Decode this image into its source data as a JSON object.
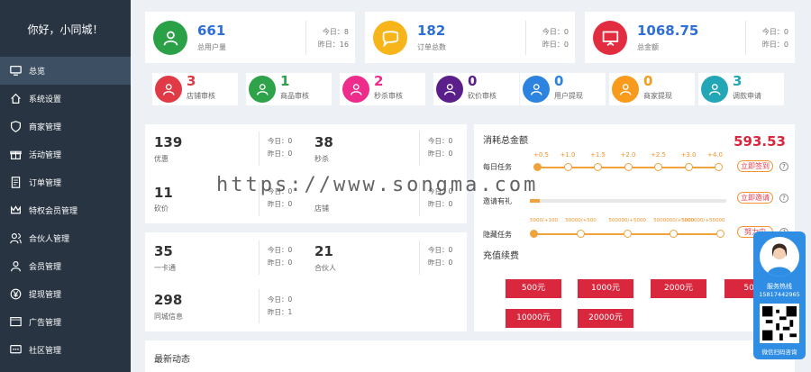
{
  "sidebar": {
    "greeting": "你好，小同城！",
    "items": [
      {
        "label": "总览",
        "icon": "monitor-icon"
      },
      {
        "label": "系统设置",
        "icon": "home-icon"
      },
      {
        "label": "商家管理",
        "icon": "shield-icon"
      },
      {
        "label": "活动管理",
        "icon": "gift-icon"
      },
      {
        "label": "订单管理",
        "icon": "document-icon"
      },
      {
        "label": "特权会员管理",
        "icon": "crown-icon"
      },
      {
        "label": "合伙人管理",
        "icon": "users-icon"
      },
      {
        "label": "会员管理",
        "icon": "user-group-icon"
      },
      {
        "label": "提现管理",
        "icon": "yen-icon"
      },
      {
        "label": "广告管理",
        "icon": "ad-icon"
      },
      {
        "label": "社区管理",
        "icon": "chat-icon"
      }
    ]
  },
  "stats": [
    {
      "value": "661",
      "label": "总用户量",
      "today_label": "今日：8",
      "yesterday_label": "昨日：16",
      "color": "#2aa146",
      "icon": "user-icon"
    },
    {
      "value": "182",
      "label": "订单总数",
      "today_label": "今日：0",
      "yesterday_label": "昨日：0",
      "color": "#f7b51a",
      "icon": "chat-bubble-icon"
    },
    {
      "value": "1068.75",
      "label": "总金额",
      "today_label": "今日：0",
      "yesterday_label": "昨日：0",
      "color": "#e12d3f",
      "icon": "presentation-icon"
    }
  ],
  "reviews": [
    {
      "value": "3",
      "label": "店铺审核",
      "color": "#e03a47"
    },
    {
      "value": "1",
      "label": "商品审核",
      "color": "#2ea349"
    },
    {
      "value": "2",
      "label": "秒杀审核",
      "color": "#ee2c8b"
    },
    {
      "value": "0",
      "label": "砍价审核",
      "color": "#5a1f8a"
    },
    {
      "value": "0",
      "label": "用户提现",
      "color": "#2d84e0"
    },
    {
      "value": "0",
      "label": "商家提现",
      "color": "#f89a1c"
    },
    {
      "value": "3",
      "label": "调款申请",
      "color": "#23a6b5"
    }
  ],
  "counts": {
    "block1": [
      {
        "value": "139",
        "label": "优惠",
        "today_label": "今日：0",
        "yesterday_label": "昨日：0"
      },
      {
        "value": "38",
        "label": "秒杀",
        "today_label": "今日：0",
        "yesterday_label": "昨日：0"
      },
      {
        "value": "11",
        "label": "砍价",
        "today_label": "今日：0",
        "yesterday_label": "昨日：0"
      },
      {
        "value": "",
        "label": "店铺",
        "today_label": "今日：0",
        "yesterday_label": "昨日：0"
      }
    ],
    "block2": [
      {
        "value": "35",
        "label": "一卡通",
        "today_label": "今日：0",
        "yesterday_label": "昨日：0"
      },
      {
        "value": "21",
        "label": "合伙人",
        "today_label": "今日：0",
        "yesterday_label": "昨日：0"
      },
      {
        "value": "298",
        "label": "同城信息",
        "today_label": "今日：0",
        "yesterday_label": "昨日：1"
      }
    ]
  },
  "consumption": {
    "title": "消耗总金额",
    "total": "593.53",
    "daily_label": "每日任务",
    "daily_ticks": [
      "+0.5",
      "+1.0",
      "+1.5",
      "+2.0",
      "+2.5",
      "+3.0",
      "+4.0"
    ],
    "daily_button": "立即签到",
    "invite_label": "邀请有礼",
    "invite_progress": 0.05,
    "invite_button": "立即邀请",
    "spend_label": "隐藏任务",
    "spend_ticks": [
      "5000/+100",
      "50000/+500",
      "500000/+5000",
      "5000000/+5000",
      "5000000/+50000"
    ],
    "spend_button": "努力中"
  },
  "recharge": {
    "title": "充值续费",
    "options": [
      "500元",
      "1000元",
      "2000元",
      "500",
      "10000元",
      "20000元"
    ]
  },
  "news": {
    "title": "最新动态"
  },
  "service": {
    "hotline_label": "服务热线",
    "phone": "15817442965",
    "qr_label": "微信扫码咨询"
  },
  "watermark": "https://www.songma.com",
  "colors": {
    "accent_blue": "#2d6fd6",
    "sidebar_bg": "#283442",
    "danger": "#d9283e"
  }
}
